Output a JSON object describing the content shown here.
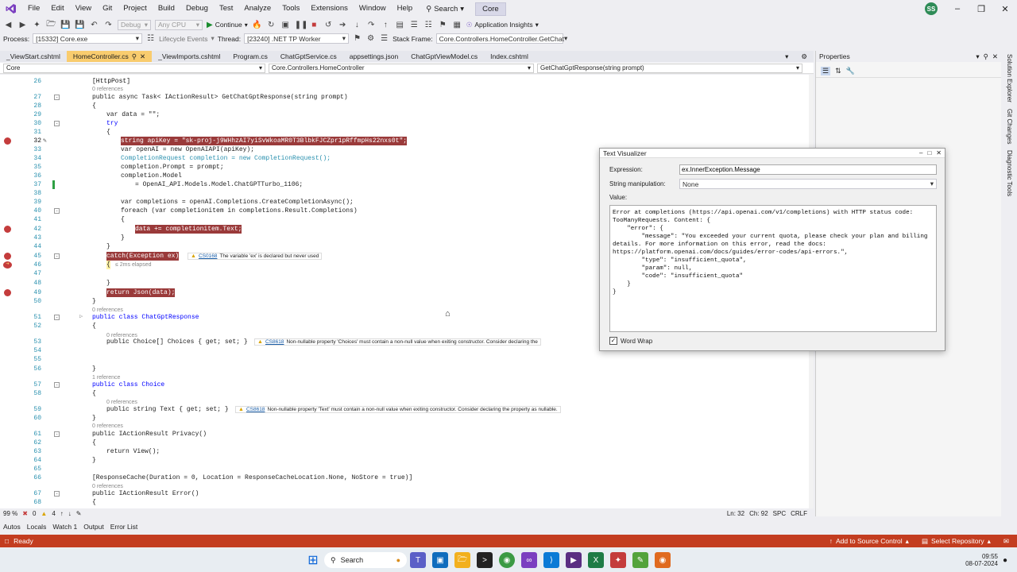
{
  "menu": [
    "File",
    "Edit",
    "View",
    "Git",
    "Project",
    "Build",
    "Debug",
    "Test",
    "Analyze",
    "Tools",
    "Extensions",
    "Window",
    "Help"
  ],
  "search_label": "Search",
  "solution_name": "Core",
  "user_initials": "SS",
  "toolbar": {
    "config": "Debug",
    "platform": "Any CPU",
    "continue_label": "Continue",
    "app_insights": "Application Insights"
  },
  "debugbar": {
    "process_label": "Process:",
    "process_value": "[15332] Core.exe",
    "lifecycle_label": "Lifecycle Events",
    "thread_label": "Thread:",
    "thread_value": "[23240] .NET TP Worker",
    "stack_label": "Stack Frame:",
    "stack_value": "Core.Controllers.HomeController.GetChat"
  },
  "tabs": [
    {
      "label": "_ViewStart.cshtml"
    },
    {
      "label": "HomeController.cs"
    },
    {
      "label": "_ViewImports.cshtml"
    },
    {
      "label": "Program.cs"
    },
    {
      "label": "ChatGptService.cs"
    },
    {
      "label": "appsettings.json"
    },
    {
      "label": "ChatGptViewModel.cs"
    },
    {
      "label": "Index.cshtml"
    }
  ],
  "nav": {
    "project": "Core",
    "class": "Core.Controllers.HomeController",
    "member": "GetChatGptResponse(string prompt)"
  },
  "code": {
    "l26": "[HttpPost]",
    "ref0": "0 references",
    "ref1": "1 reference",
    "l27": "public async Task< IActionResult> GetChatGptResponse(string prompt)",
    "l28": "{",
    "l29": "var data = \"\";",
    "l30": "try",
    "l31": "{",
    "l32": "string apiKey = \"sk-proj-j9WHhzAI7yiSvWkoaMR0T3BlbkFJCZpr1pRffmpHs22nxs0t\";",
    "l33": "var openAI = new OpenAIAPI(apiKey);",
    "l34": "CompletionRequest completion = new CompletionRequest();",
    "l35": "completion.Prompt = prompt;",
    "l36": "completion.Model",
    "l37": "= OpenAI_API.Models.Model.ChatGPTTurbo_1106;",
    "l38": "",
    "l39": "var completions = openAI.Completions.CreateCompletionAsync();",
    "l40": "foreach (var completionitem in completions.Result.Completions)",
    "l41": "{",
    "l42": "data += completionitem.Text;",
    "l43": "}",
    "l44": "}",
    "l45": "catch(Exception ex)",
    "l46": "{",
    "elapsed": "≤ 2ms elapsed",
    "l48": "}",
    "l49": "return Json(data);",
    "l50": "}",
    "l51": "public class ChatGptResponse",
    "l52": "{",
    "l53": "public Choice[] Choices { get; set; }",
    "l56": "}",
    "l57": "public class Choice",
    "l58": "{",
    "l59": "public string Text { get; set; }",
    "l60": "}",
    "l61": "public IActionResult Privacy()",
    "l62": "{",
    "l63": "return View();",
    "l64": "}",
    "l66": "[ResponseCache(Duration = 0, Location = ResponseCacheLocation.None, NoStore = true)]",
    "l67": "public IActionResult Error()",
    "l68": "{"
  },
  "warnings": {
    "w45_code": "CS0168",
    "w45_text": "The variable 'ex' is declared but never used",
    "w53_code": "CS8618",
    "w53_text": "Non-nullable property 'Choices' must contain a non-null value when exiting constructor. Consider declaring the",
    "w59_code": "CS8618",
    "w59_text": "Non-nullable property 'Text' must contain a non-null value when exiting constructor. Consider declaring the property as nullable."
  },
  "editor_status": {
    "zoom": "99 %",
    "errors": "0",
    "warnings": "4",
    "ln": "Ln: 32",
    "ch": "Ch: 92",
    "spc": "SPC",
    "crlf": "CRLF"
  },
  "bottom_tabs": [
    "Autos",
    "Locals",
    "Watch 1",
    "Output",
    "Error List"
  ],
  "status": {
    "ready": "Ready",
    "source_control": "Add to Source Control",
    "repo": "Select Repository"
  },
  "properties_title": "Properties",
  "right_rail": [
    "Solution Explorer",
    "Git Changes",
    "Diagnostic Tools"
  ],
  "visualizer": {
    "title": "Text Visualizer",
    "expression_label": "Expression:",
    "expression_value": "ex.InnerException.Message",
    "manip_label": "String manipulation:",
    "manip_value": "None",
    "value_label": "Value:",
    "value_text": "Error at completions (https://api.openai.com/v1/completions) with HTTP status code: TooManyRequests. Content: {\n    \"error\": {\n        \"message\": \"You exceeded your current quota, please check your plan and billing details. For more information on this error, read the docs: https://platform.openai.com/docs/guides/error-codes/api-errors.\",\n        \"type\": \"insufficient_quota\",\n        \"param\": null,\n        \"code\": \"insufficient_quota\"\n    }\n}",
    "wordwrap_label": "Word Wrap"
  },
  "taskbar": {
    "search": "Search",
    "time": "09:55",
    "date": "08-07-2024"
  },
  "colors": {
    "statusbar": "#c33d20",
    "active_tab": "#f9cc6e",
    "breakpoint": "#c43c3c"
  }
}
